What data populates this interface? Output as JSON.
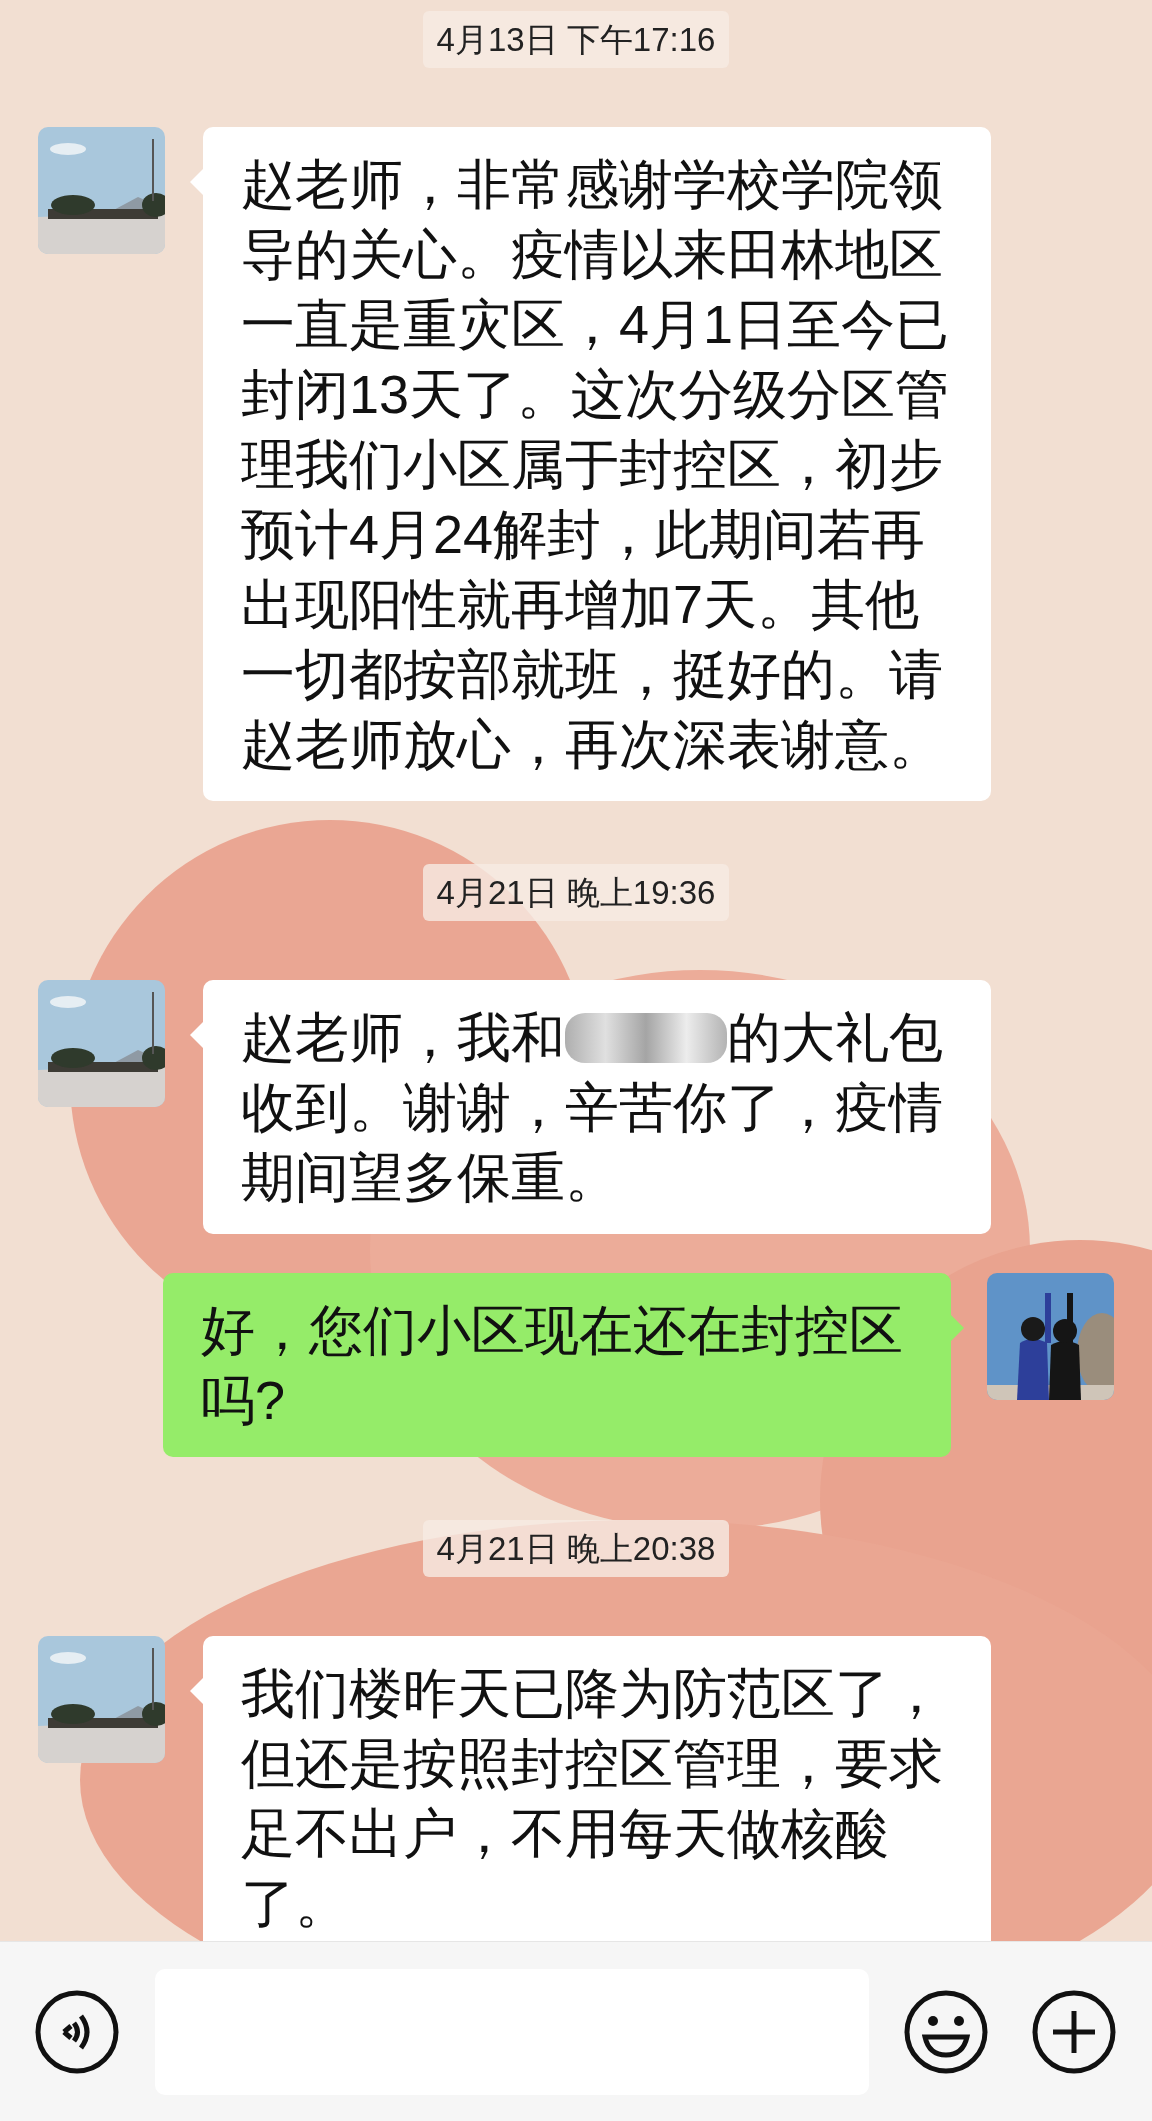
{
  "messages": [
    {
      "kind": "time",
      "text": "4月13日 下午17:16"
    },
    {
      "kind": "incoming",
      "parts": [
        {
          "text": "赵老师，非常感谢学校学院领导的关心。疫情以来田林地区一直是重灾区，4月1日至今已封闭13天了。这次分级分区管理我们小区属于封控区，初步预计4月24解封，此期间若再出现阳性就再增加7天。其他一切都按部就班，挺好的。请赵老师放心，再次深表谢意。"
        }
      ]
    },
    {
      "kind": "time",
      "text": "4月21日 晚上19:36"
    },
    {
      "kind": "incoming",
      "parts": [
        {
          "text": "赵老师，我和"
        },
        {
          "kind": "blur"
        },
        {
          "text": "的大礼包"
        },
        {
          "text": "收到。谢谢，辛苦你了，疫情期间望多保重。",
          "new_line": true
        }
      ]
    },
    {
      "kind": "outgoing",
      "parts": [
        {
          "text": "好，您们小区现在还在封控区吗?"
        }
      ]
    },
    {
      "kind": "time",
      "text": "4月21日 晚上20:38"
    },
    {
      "kind": "incoming",
      "parts": [
        {
          "text": "我们楼昨天已降为防范区了，但还是按照封控区管理，要求足不出户，不用每天做核酸了。"
        }
      ]
    }
  ]
}
